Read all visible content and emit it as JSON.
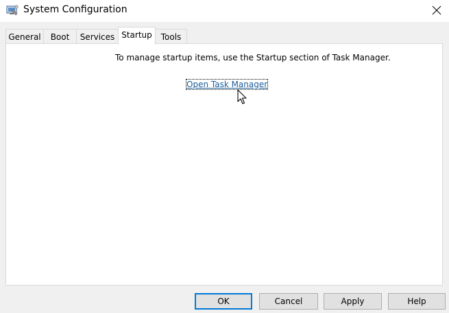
{
  "window": {
    "title": "System Configuration",
    "close_glyph": "✕"
  },
  "tabs": [
    {
      "label": "General",
      "active": false
    },
    {
      "label": "Boot",
      "active": false
    },
    {
      "label": "Services",
      "active": false
    },
    {
      "label": "Startup",
      "active": true
    },
    {
      "label": "Tools",
      "active": false
    }
  ],
  "startup": {
    "message": "To manage startup items, use the Startup section of Task Manager.",
    "link_label": "Open Task Manager"
  },
  "buttons": {
    "ok": "OK",
    "cancel": "Cancel",
    "apply": "Apply",
    "help": "Help"
  },
  "colors": {
    "link": "#1a5e9a",
    "default_button_border": "#0078d7"
  },
  "icons": {
    "app": "system-configuration-icon",
    "close": "close-icon",
    "pointer": "mouse-pointer-icon"
  }
}
